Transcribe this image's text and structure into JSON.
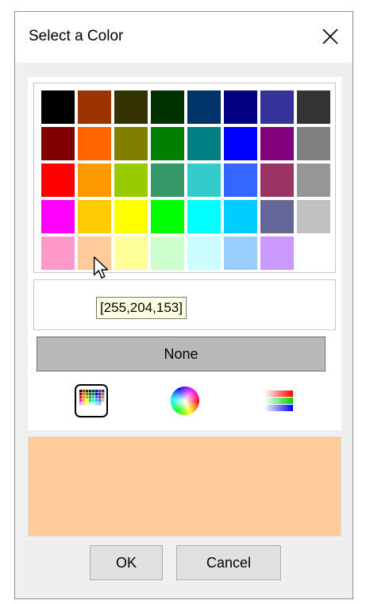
{
  "dialog": {
    "title": "Select a Color",
    "close_icon": "close-icon"
  },
  "palette": {
    "rows": [
      [
        "#000000",
        "#993300",
        "#333300",
        "#003300",
        "#003366",
        "#000080",
        "#333399",
        "#333333"
      ],
      [
        "#800000",
        "#FF6600",
        "#808000",
        "#008000",
        "#008080",
        "#0000FF",
        "#800080",
        "#808080"
      ],
      [
        "#FF0000",
        "#FF9900",
        "#99CC00",
        "#339966",
        "#33CCCC",
        "#3366FF",
        "#993366",
        "#969696"
      ],
      [
        "#FF00FF",
        "#FFCC00",
        "#FFFF00",
        "#00FF00",
        "#00FFFF",
        "#00CCFF",
        "#666699",
        "#C0C0C0"
      ],
      [
        "#FF99CC",
        "#FFCC99",
        "#FFFF99",
        "#CCFFCC",
        "#CCFFFF",
        "#99CCFF",
        "#CC99FF"
      ]
    ],
    "hovered_swatch": "#FFCC99"
  },
  "tooltip": {
    "text": "[255,204,153]"
  },
  "none_button": {
    "label": "None"
  },
  "modes": [
    {
      "icon": "palette-grid-icon",
      "selected": true
    },
    {
      "icon": "color-wheel-icon",
      "selected": false
    },
    {
      "icon": "rgb-sliders-icon",
      "selected": false
    }
  ],
  "preview": {
    "color": "#FFCC99"
  },
  "buttons": {
    "ok_label": "OK",
    "cancel_label": "Cancel"
  }
}
